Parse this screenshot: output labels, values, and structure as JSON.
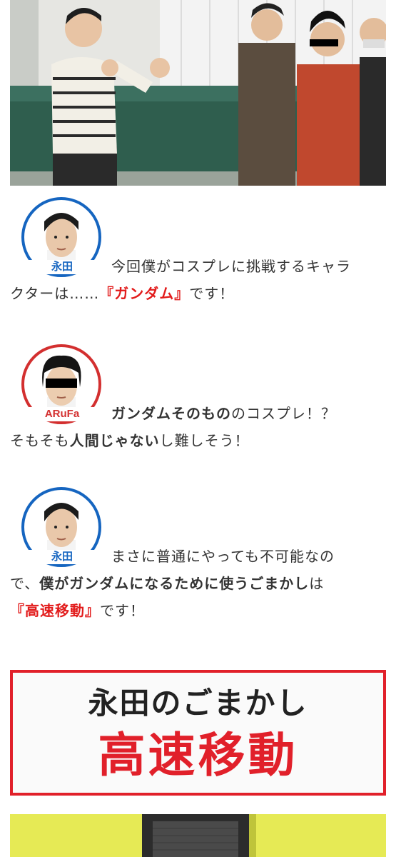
{
  "hero_image": {
    "alt": "",
    "icon": "photo"
  },
  "conversation": [
    {
      "speaker": "永田",
      "speaker_color": "#1565c0",
      "line1": "今回僕がコスプレに挑戦するキャラ",
      "line2_plain": "クターは……",
      "line2_red": "『ガンダム』",
      "line2_tail": "です！"
    },
    {
      "speaker": "ARuFa",
      "speaker_color": "#d32f2f",
      "line1_bold": "ガンダムそのもの",
      "line1_tail": "のコスプレ！？",
      "line2_head": "そもそも",
      "line2_bold": "人間じゃない",
      "line2_tail": "し難しそう！"
    },
    {
      "speaker": "永田",
      "speaker_color": "#1565c0",
      "line1": "まさに普通にやっても不可能なの",
      "line2_head": "で、",
      "line2_bold1": "僕がガンダムになるために使うごまかし",
      "line2_tail": "は",
      "line3_red": "『高速移動』",
      "line3_tail": "です！"
    }
  ],
  "title_card": {
    "line1": "永田のごまかし",
    "line2": "高速移動",
    "border_color": "#e1202a"
  },
  "bottom_image": {
    "icon": "photo"
  }
}
